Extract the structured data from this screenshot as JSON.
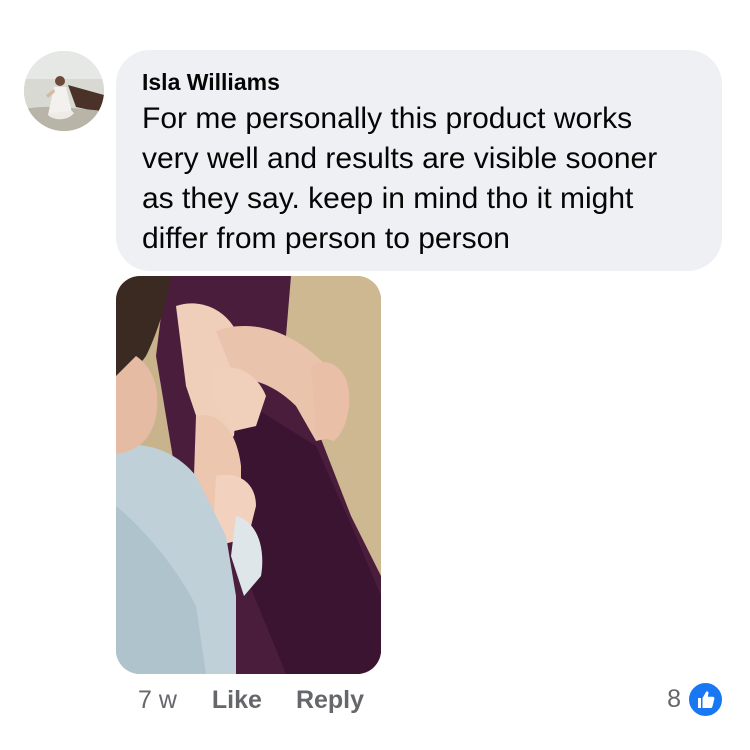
{
  "comment": {
    "author": "Isla Williams",
    "text": "For me personally this product works\nvery well and results are visible sooner\nas they say. keep in mind tho it might\ndiffer from person to person"
  },
  "attachment": {
    "icon": "photo-attachment"
  },
  "actions": {
    "time": "7 w",
    "like_label": "Like",
    "reply_label": "Reply"
  },
  "reactions": {
    "count": "8",
    "icon": "thumbs-up-icon",
    "color": "#1877f2"
  },
  "colors": {
    "bubble": "#eff0f3",
    "meta_text": "#65676b",
    "text": "#050505"
  }
}
